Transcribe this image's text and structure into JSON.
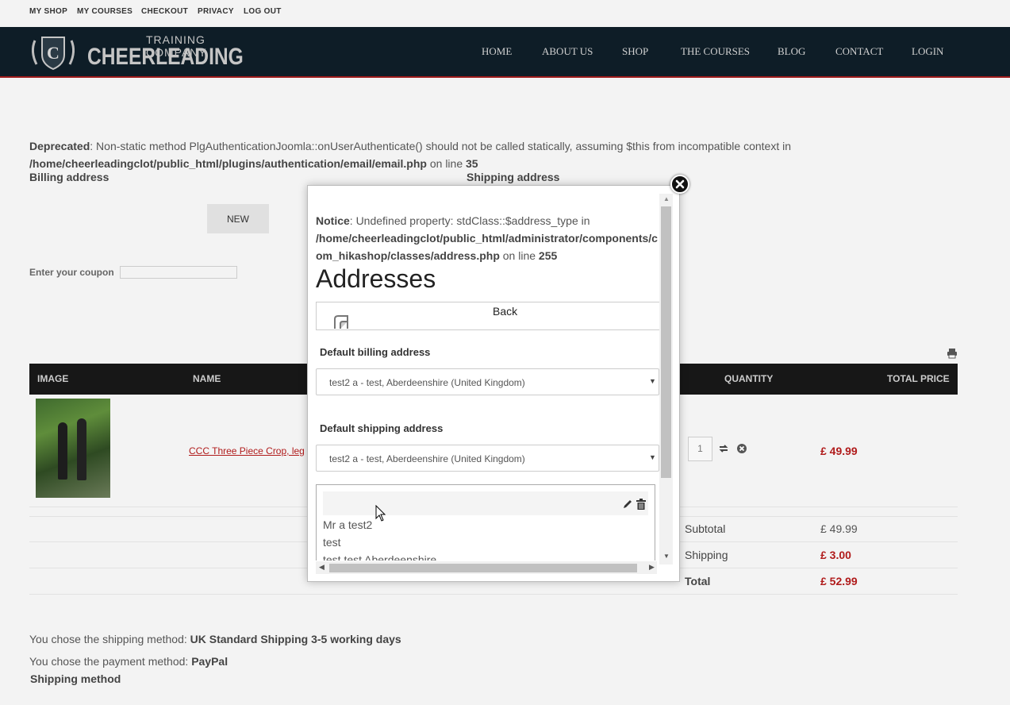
{
  "topbar": {
    "links": [
      "MY SHOP",
      "MY COURSES",
      "CHECKOUT",
      "PRIVACY",
      "LOG OUT"
    ]
  },
  "header": {
    "logo_top": "TRAINING COMPANY",
    "logo_main": "CHEERLEADING",
    "nav": [
      "HOME",
      "ABOUT US",
      "SHOP",
      "THE COURSES",
      "BLOG",
      "CONTACT",
      "LOGIN"
    ]
  },
  "notice": {
    "label": "Deprecated",
    "text": ": Non-static method PlgAuthenticationJoomla::onUserAuthenticate() should not be called statically, assuming $this from incompatible context in",
    "path": "/home/cheerleadingclot/public_html/plugins/authentication/email/email.php",
    "on_line": " on line ",
    "line": "35"
  },
  "checkout": {
    "billing_heading": "Billing address",
    "shipping_heading": "Shipping address",
    "new_button": "NEW",
    "coupon_label": "Enter your coupon",
    "coupon_value": ""
  },
  "cart": {
    "columns": [
      "IMAGE",
      "NAME",
      "QUANTITY",
      "TOTAL PRICE"
    ],
    "item": {
      "name": "CCC Three Piece Crop, leg",
      "quantity": "1",
      "price": "£ 49.99"
    },
    "subtotal_label": "Subtotal",
    "subtotal_value": "£ 49.99",
    "shipping_label": "Shipping",
    "shipping_value": "£ 3.00",
    "total_label": "Total",
    "total_value": "£ 52.99"
  },
  "footer": {
    "shipping_text": "You chose the shipping method: ",
    "shipping_value": "UK Standard Shipping 3-5 working days",
    "payment_text": "You chose the payment method: ",
    "payment_value": "PayPal",
    "shipping_method_heading": "Shipping method"
  },
  "modal": {
    "notice_label": "Notice",
    "notice_text": ": Undefined property: stdClass::$address_type in",
    "notice_path_1": "/home/cheerleadingclot/public_html/administrator/components/c",
    "notice_path_2": "om_hikashop/classes/address.php",
    "notice_on_line": " on line ",
    "notice_line": "255",
    "title": "Addresses",
    "back_label": "Back",
    "default_billing_label": "Default billing address",
    "default_billing_value": "test2 a - test, Aberdeenshire (United Kingdom)",
    "default_shipping_label": "Default shipping address",
    "default_shipping_value": "test2 a - test, Aberdeenshire (United Kingdom)",
    "address_lines": [
      "Mr a test2",
      "test",
      "test test Aberdeenshire"
    ]
  },
  "colors": {
    "header_bg": "#0e1d27",
    "header_border": "#9e1b1b",
    "price_red": "#b01b1b",
    "table_head_bg": "#171717"
  }
}
